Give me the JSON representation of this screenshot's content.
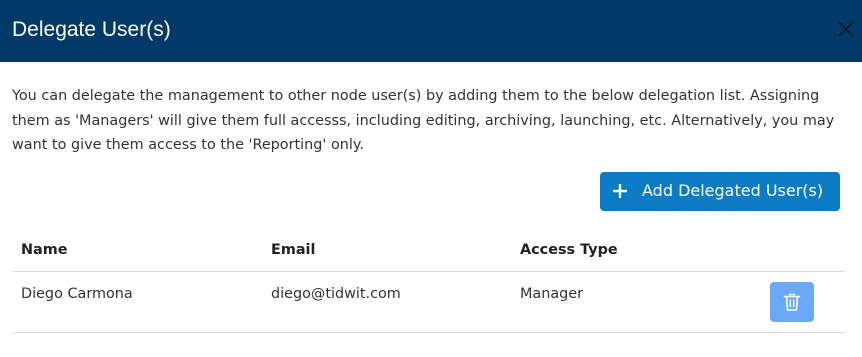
{
  "dialog": {
    "title": "Delegate User(s)",
    "close_icon": "close-icon",
    "description": "You can delegate the management to other node user(s) by adding them to the below delegation list. Assigning them as 'Managers' will give them full accesss, including editing, archiving, launching, etc. Alternatively, you may want to give them access to the 'Reporting' only.",
    "add_button": {
      "label": "Add Delegated User(s)",
      "icon": "plus-icon",
      "color": "#0b7bc3"
    }
  },
  "table": {
    "headers": {
      "name": "Name",
      "email": "Email",
      "access": "Access Type"
    },
    "rows": [
      {
        "name": "Diego Carmona",
        "email": "diego@tidwit.com",
        "access": "Manager",
        "delete_icon": "trash-icon"
      }
    ]
  },
  "colors": {
    "header_bg": "#013a68",
    "delete_button": "#6aa8f8"
  }
}
